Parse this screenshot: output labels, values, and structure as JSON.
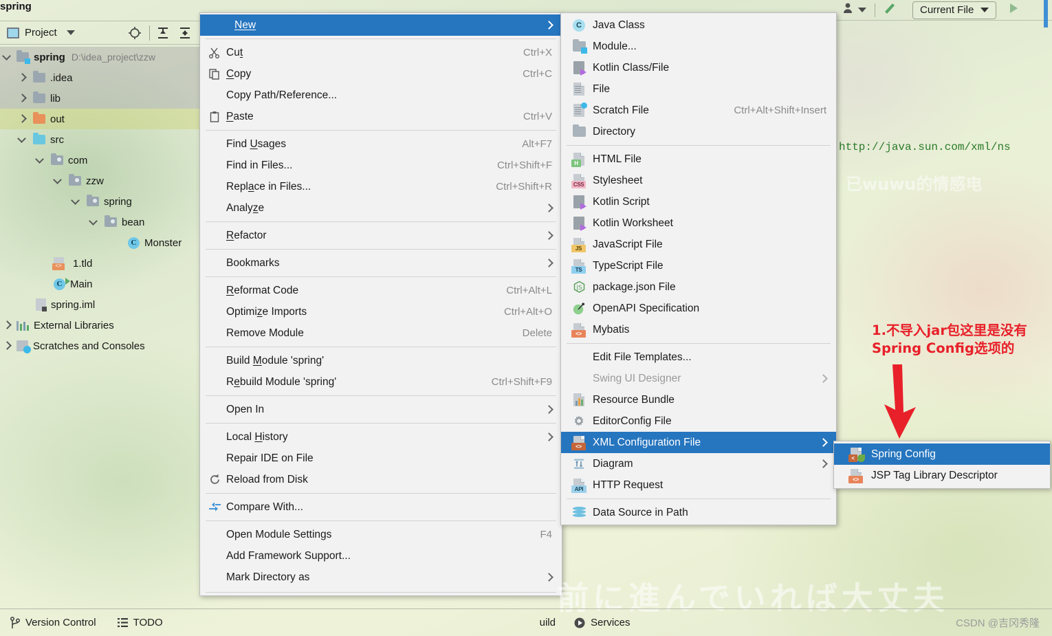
{
  "window": {
    "title": "spring"
  },
  "project_panel": {
    "toolbar": {
      "label": "Project",
      "icons": [
        "project-view-icon",
        "chevron-down-icon",
        "locate-icon",
        "expand-all-icon",
        "collapse-all-icon"
      ]
    },
    "tree": [
      {
        "label": "spring",
        "path": "D:\\idea_project\\zzw",
        "icon": "module-folder-icon",
        "depth": 0,
        "arrow": "down",
        "bold": true,
        "state": "selected-grey"
      },
      {
        "label": ".idea",
        "path": "",
        "icon": "folder-icon",
        "depth": 1,
        "arrow": "right",
        "bold": false,
        "state": "selected-grey"
      },
      {
        "label": "lib",
        "path": "",
        "icon": "folder-icon",
        "depth": 1,
        "arrow": "right",
        "bold": false,
        "state": "selected-grey"
      },
      {
        "label": "out",
        "path": "",
        "icon": "folder-orange-icon",
        "depth": 1,
        "arrow": "right",
        "bold": false,
        "state": "selected-yellow"
      },
      {
        "label": "src",
        "path": "",
        "icon": "folder-source-icon",
        "depth": 1,
        "arrow": "down",
        "bold": false,
        "state": "none"
      },
      {
        "label": "com",
        "path": "",
        "icon": "package-icon",
        "depth": 2,
        "arrow": "down",
        "bold": false,
        "state": "none"
      },
      {
        "label": "zzw",
        "path": "",
        "icon": "package-icon",
        "depth": 3,
        "arrow": "down",
        "bold": false,
        "state": "none"
      },
      {
        "label": "spring",
        "path": "",
        "icon": "package-icon",
        "depth": 4,
        "arrow": "down",
        "bold": false,
        "state": "none"
      },
      {
        "label": "bean",
        "path": "",
        "icon": "package-icon",
        "depth": 5,
        "arrow": "down",
        "bold": false,
        "state": "none"
      },
      {
        "label": "Monster",
        "path": "",
        "icon": "java-class-icon",
        "depth": 6,
        "arrow": "none",
        "bold": false,
        "state": "none"
      },
      {
        "label": "1.tld",
        "path": "",
        "icon": "tld-file-icon",
        "depth": 3,
        "arrow": "none",
        "bold": false,
        "state": "none"
      },
      {
        "label": "Main",
        "path": "",
        "icon": "java-class-run-icon",
        "depth": 3,
        "arrow": "none",
        "bold": false,
        "state": "none"
      },
      {
        "label": "spring.iml",
        "path": "",
        "icon": "iml-file-icon",
        "depth": 2,
        "arrow": "none",
        "bold": false,
        "state": "none"
      },
      {
        "label": "External Libraries",
        "path": "",
        "icon": "libraries-icon",
        "depth": 0,
        "arrow": "right",
        "bold": false,
        "state": "none"
      },
      {
        "label": "Scratches and Consoles",
        "path": "",
        "icon": "scratches-icon",
        "depth": 0,
        "arrow": "right",
        "bold": false,
        "state": "none"
      }
    ]
  },
  "top_toolbar": {
    "run_config": "Current File",
    "icons": [
      "user-icon",
      "chevron-down-icon",
      "updates-icon",
      "run-icon"
    ]
  },
  "editor": {
    "code_line": "http://java.sun.com/xml/ns",
    "ghost_text": "已wuwu的情感电"
  },
  "context_menu": {
    "items": [
      {
        "label": "New",
        "mnemonic": "N",
        "shortcut": "",
        "icon": "",
        "submenu": true,
        "highlight": true
      },
      {
        "type": "separator"
      },
      {
        "label": "Cut",
        "mnemonic": "t",
        "shortcut": "Ctrl+X",
        "icon": "scissors-icon",
        "submenu": false
      },
      {
        "label": "Copy",
        "mnemonic": "C",
        "shortcut": "Ctrl+C",
        "icon": "copy-icon",
        "submenu": false
      },
      {
        "label": "Copy Path/Reference...",
        "mnemonic": "",
        "shortcut": "",
        "icon": "",
        "submenu": false
      },
      {
        "label": "Paste",
        "mnemonic": "P",
        "shortcut": "Ctrl+V",
        "icon": "paste-icon",
        "submenu": false
      },
      {
        "type": "separator"
      },
      {
        "label": "Find Usages",
        "mnemonic": "U",
        "shortcut": "Alt+F7",
        "icon": "",
        "submenu": false
      },
      {
        "label": "Find in Files...",
        "mnemonic": "",
        "shortcut": "Ctrl+Shift+F",
        "icon": "",
        "submenu": false
      },
      {
        "label": "Replace in Files...",
        "mnemonic": "a",
        "shortcut": "Ctrl+Shift+R",
        "icon": "",
        "submenu": false
      },
      {
        "label": "Analyze",
        "mnemonic": "z",
        "shortcut": "",
        "icon": "",
        "submenu": true
      },
      {
        "type": "separator"
      },
      {
        "label": "Refactor",
        "mnemonic": "R",
        "shortcut": "",
        "icon": "",
        "submenu": true
      },
      {
        "type": "separator"
      },
      {
        "label": "Bookmarks",
        "mnemonic": "",
        "shortcut": "",
        "icon": "",
        "submenu": true
      },
      {
        "type": "separator"
      },
      {
        "label": "Reformat Code",
        "mnemonic": "R",
        "shortcut": "Ctrl+Alt+L",
        "icon": "",
        "submenu": false
      },
      {
        "label": "Optimize Imports",
        "mnemonic": "z",
        "shortcut": "Ctrl+Alt+O",
        "icon": "",
        "submenu": false
      },
      {
        "label": "Remove Module",
        "mnemonic": "",
        "shortcut": "Delete",
        "icon": "",
        "submenu": false
      },
      {
        "type": "separator"
      },
      {
        "label": "Build Module 'spring'",
        "mnemonic": "M",
        "shortcut": "",
        "icon": "",
        "submenu": false
      },
      {
        "label": "Rebuild Module 'spring'",
        "mnemonic": "e",
        "shortcut": "Ctrl+Shift+F9",
        "icon": "",
        "submenu": false
      },
      {
        "type": "separator"
      },
      {
        "label": "Open In",
        "mnemonic": "",
        "shortcut": "",
        "icon": "",
        "submenu": true
      },
      {
        "type": "separator"
      },
      {
        "label": "Local History",
        "mnemonic": "H",
        "shortcut": "",
        "icon": "",
        "submenu": true
      },
      {
        "label": "Repair IDE on File",
        "mnemonic": "",
        "shortcut": "",
        "icon": "",
        "submenu": false
      },
      {
        "label": "Reload from Disk",
        "mnemonic": "",
        "shortcut": "",
        "icon": "reload-icon",
        "submenu": false
      },
      {
        "type": "separator"
      },
      {
        "label": "Compare With...",
        "mnemonic": "",
        "shortcut": "",
        "icon": "compare-icon",
        "submenu": false
      },
      {
        "type": "separator"
      },
      {
        "label": "Open Module Settings",
        "mnemonic": "",
        "shortcut": "F4",
        "icon": "",
        "submenu": false
      },
      {
        "label": "Add Framework Support...",
        "mnemonic": "",
        "shortcut": "",
        "icon": "",
        "submenu": false
      },
      {
        "label": "Mark Directory as",
        "mnemonic": "",
        "shortcut": "",
        "icon": "",
        "submenu": true
      },
      {
        "type": "separator"
      }
    ]
  },
  "new_submenu": {
    "items": [
      {
        "label": "Java Class",
        "shortcut": "",
        "icon": "java-class-icon",
        "submenu": false
      },
      {
        "label": "Module...",
        "shortcut": "",
        "icon": "module-icon",
        "submenu": false
      },
      {
        "label": "Kotlin Class/File",
        "shortcut": "",
        "icon": "kotlin-icon",
        "submenu": false
      },
      {
        "label": "File",
        "shortcut": "",
        "icon": "file-icon",
        "submenu": false
      },
      {
        "label": "Scratch File",
        "shortcut": "Ctrl+Alt+Shift+Insert",
        "icon": "scratch-file-icon",
        "submenu": false
      },
      {
        "label": "Directory",
        "shortcut": "",
        "icon": "directory-icon",
        "submenu": false
      },
      {
        "type": "separator"
      },
      {
        "label": "HTML File",
        "shortcut": "",
        "icon": "html-file-icon",
        "submenu": false
      },
      {
        "label": "Stylesheet",
        "shortcut": "",
        "icon": "css-file-icon",
        "submenu": false
      },
      {
        "label": "Kotlin Script",
        "shortcut": "",
        "icon": "kotlin-script-icon",
        "submenu": false
      },
      {
        "label": "Kotlin Worksheet",
        "shortcut": "",
        "icon": "kotlin-worksheet-icon",
        "submenu": false
      },
      {
        "label": "JavaScript File",
        "shortcut": "",
        "icon": "js-file-icon",
        "submenu": false
      },
      {
        "label": "TypeScript File",
        "shortcut": "",
        "icon": "ts-file-icon",
        "submenu": false
      },
      {
        "label": "package.json File",
        "shortcut": "",
        "icon": "node-icon",
        "submenu": false
      },
      {
        "label": "OpenAPI Specification",
        "shortcut": "",
        "icon": "openapi-icon",
        "submenu": false
      },
      {
        "label": "Mybatis",
        "shortcut": "",
        "icon": "mybatis-icon",
        "submenu": false
      },
      {
        "type": "separator"
      },
      {
        "label": "Edit File Templates...",
        "shortcut": "",
        "icon": "",
        "submenu": false
      },
      {
        "label": "Swing UI Designer",
        "shortcut": "",
        "icon": "",
        "submenu": true,
        "disabled": true
      },
      {
        "label": "Resource Bundle",
        "shortcut": "",
        "icon": "resource-bundle-icon",
        "submenu": false
      },
      {
        "label": "EditorConfig File",
        "shortcut": "",
        "icon": "gear-icon",
        "submenu": false
      },
      {
        "label": "XML Configuration File",
        "shortcut": "",
        "icon": "xml-file-icon",
        "submenu": true,
        "highlight": true
      },
      {
        "label": "Diagram",
        "shortcut": "",
        "icon": "diagram-icon",
        "submenu": true
      },
      {
        "label": "HTTP Request",
        "shortcut": "",
        "icon": "http-request-icon",
        "submenu": false
      },
      {
        "type": "separator"
      },
      {
        "label": "Data Source in Path",
        "shortcut": "",
        "icon": "database-icon",
        "submenu": false
      }
    ]
  },
  "xml_submenu": {
    "items": [
      {
        "label": "Spring Config",
        "icon": "spring-config-icon",
        "highlight": true
      },
      {
        "label": "JSP Tag Library Descriptor",
        "icon": "tld-file-icon",
        "highlight": false
      }
    ]
  },
  "annotation": {
    "line1": "1.不导入jar包这里是没有",
    "line2": "Spring Config选项的",
    "color": "#e8202a"
  },
  "status_bar": {
    "left_items": [
      {
        "label": "Version Control",
        "icon": "branch-icon"
      },
      {
        "label": "TODO",
        "icon": "todo-list-icon"
      }
    ],
    "right_items": [
      {
        "label": "uild",
        "icon": ""
      },
      {
        "label": "Services",
        "icon": "services-play-icon"
      }
    ],
    "watermark": "CSDN @吉冈秀隆",
    "background_text": "前に進んでいれば大丈夫"
  }
}
